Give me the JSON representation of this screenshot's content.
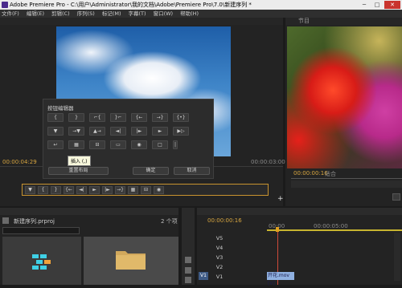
{
  "window": {
    "title": "Adobe Premiere Pro - C:\\用户\\Administrator\\我的文档\\Adobe\\Premiere Pro\\7.0\\新建序列 *",
    "min": "─",
    "max": "□",
    "close": "✕"
  },
  "menu": [
    "文件(F)",
    "编辑(E)",
    "剪辑(C)",
    "序列(S)",
    "标记(M)",
    "字幕(T)",
    "窗口(W)",
    "帮助(H)"
  ],
  "source": {
    "timecode": "00:00:04:29",
    "end_timecode": "00:00:03:00"
  },
  "program": {
    "panel_label": "节目",
    "timecode": "00:00:00:16",
    "fit": "适合"
  },
  "button_editor": {
    "title": "按钮编辑器",
    "rows": [
      [
        "{",
        "}",
        "⌐{",
        "}⌐",
        "{←",
        "→}",
        "{•}"
      ],
      [
        "▼",
        "→▼",
        "▲→",
        "◄|",
        "|►",
        "►",
        "▶▷"
      ],
      [
        "↩",
        "▦",
        "⊟",
        "▭",
        "◉",
        "□",
        "|"
      ]
    ],
    "tooltip": "插入 (,)",
    "reset": "重置布局",
    "ok": "确定",
    "cancel": "取消"
  },
  "transport": [
    "▼",
    "{",
    "}",
    "{←",
    "◄|",
    "►",
    "|►",
    "→}",
    "▦",
    "⊟",
    "◉"
  ],
  "project": {
    "name": "新建序列.prproj",
    "count": "2 个项"
  },
  "timeline": {
    "timecode": "00:00:00:16",
    "ruler": [
      "00:00",
      "00:00:05:00"
    ],
    "tracks": [
      "V5",
      "V4",
      "V3",
      "V2",
      "V1"
    ],
    "source_patch": "V1",
    "clip": "开花.mov [V]"
  },
  "colors": {
    "accent": "#c8932f",
    "clip": "#8fb0e0"
  }
}
